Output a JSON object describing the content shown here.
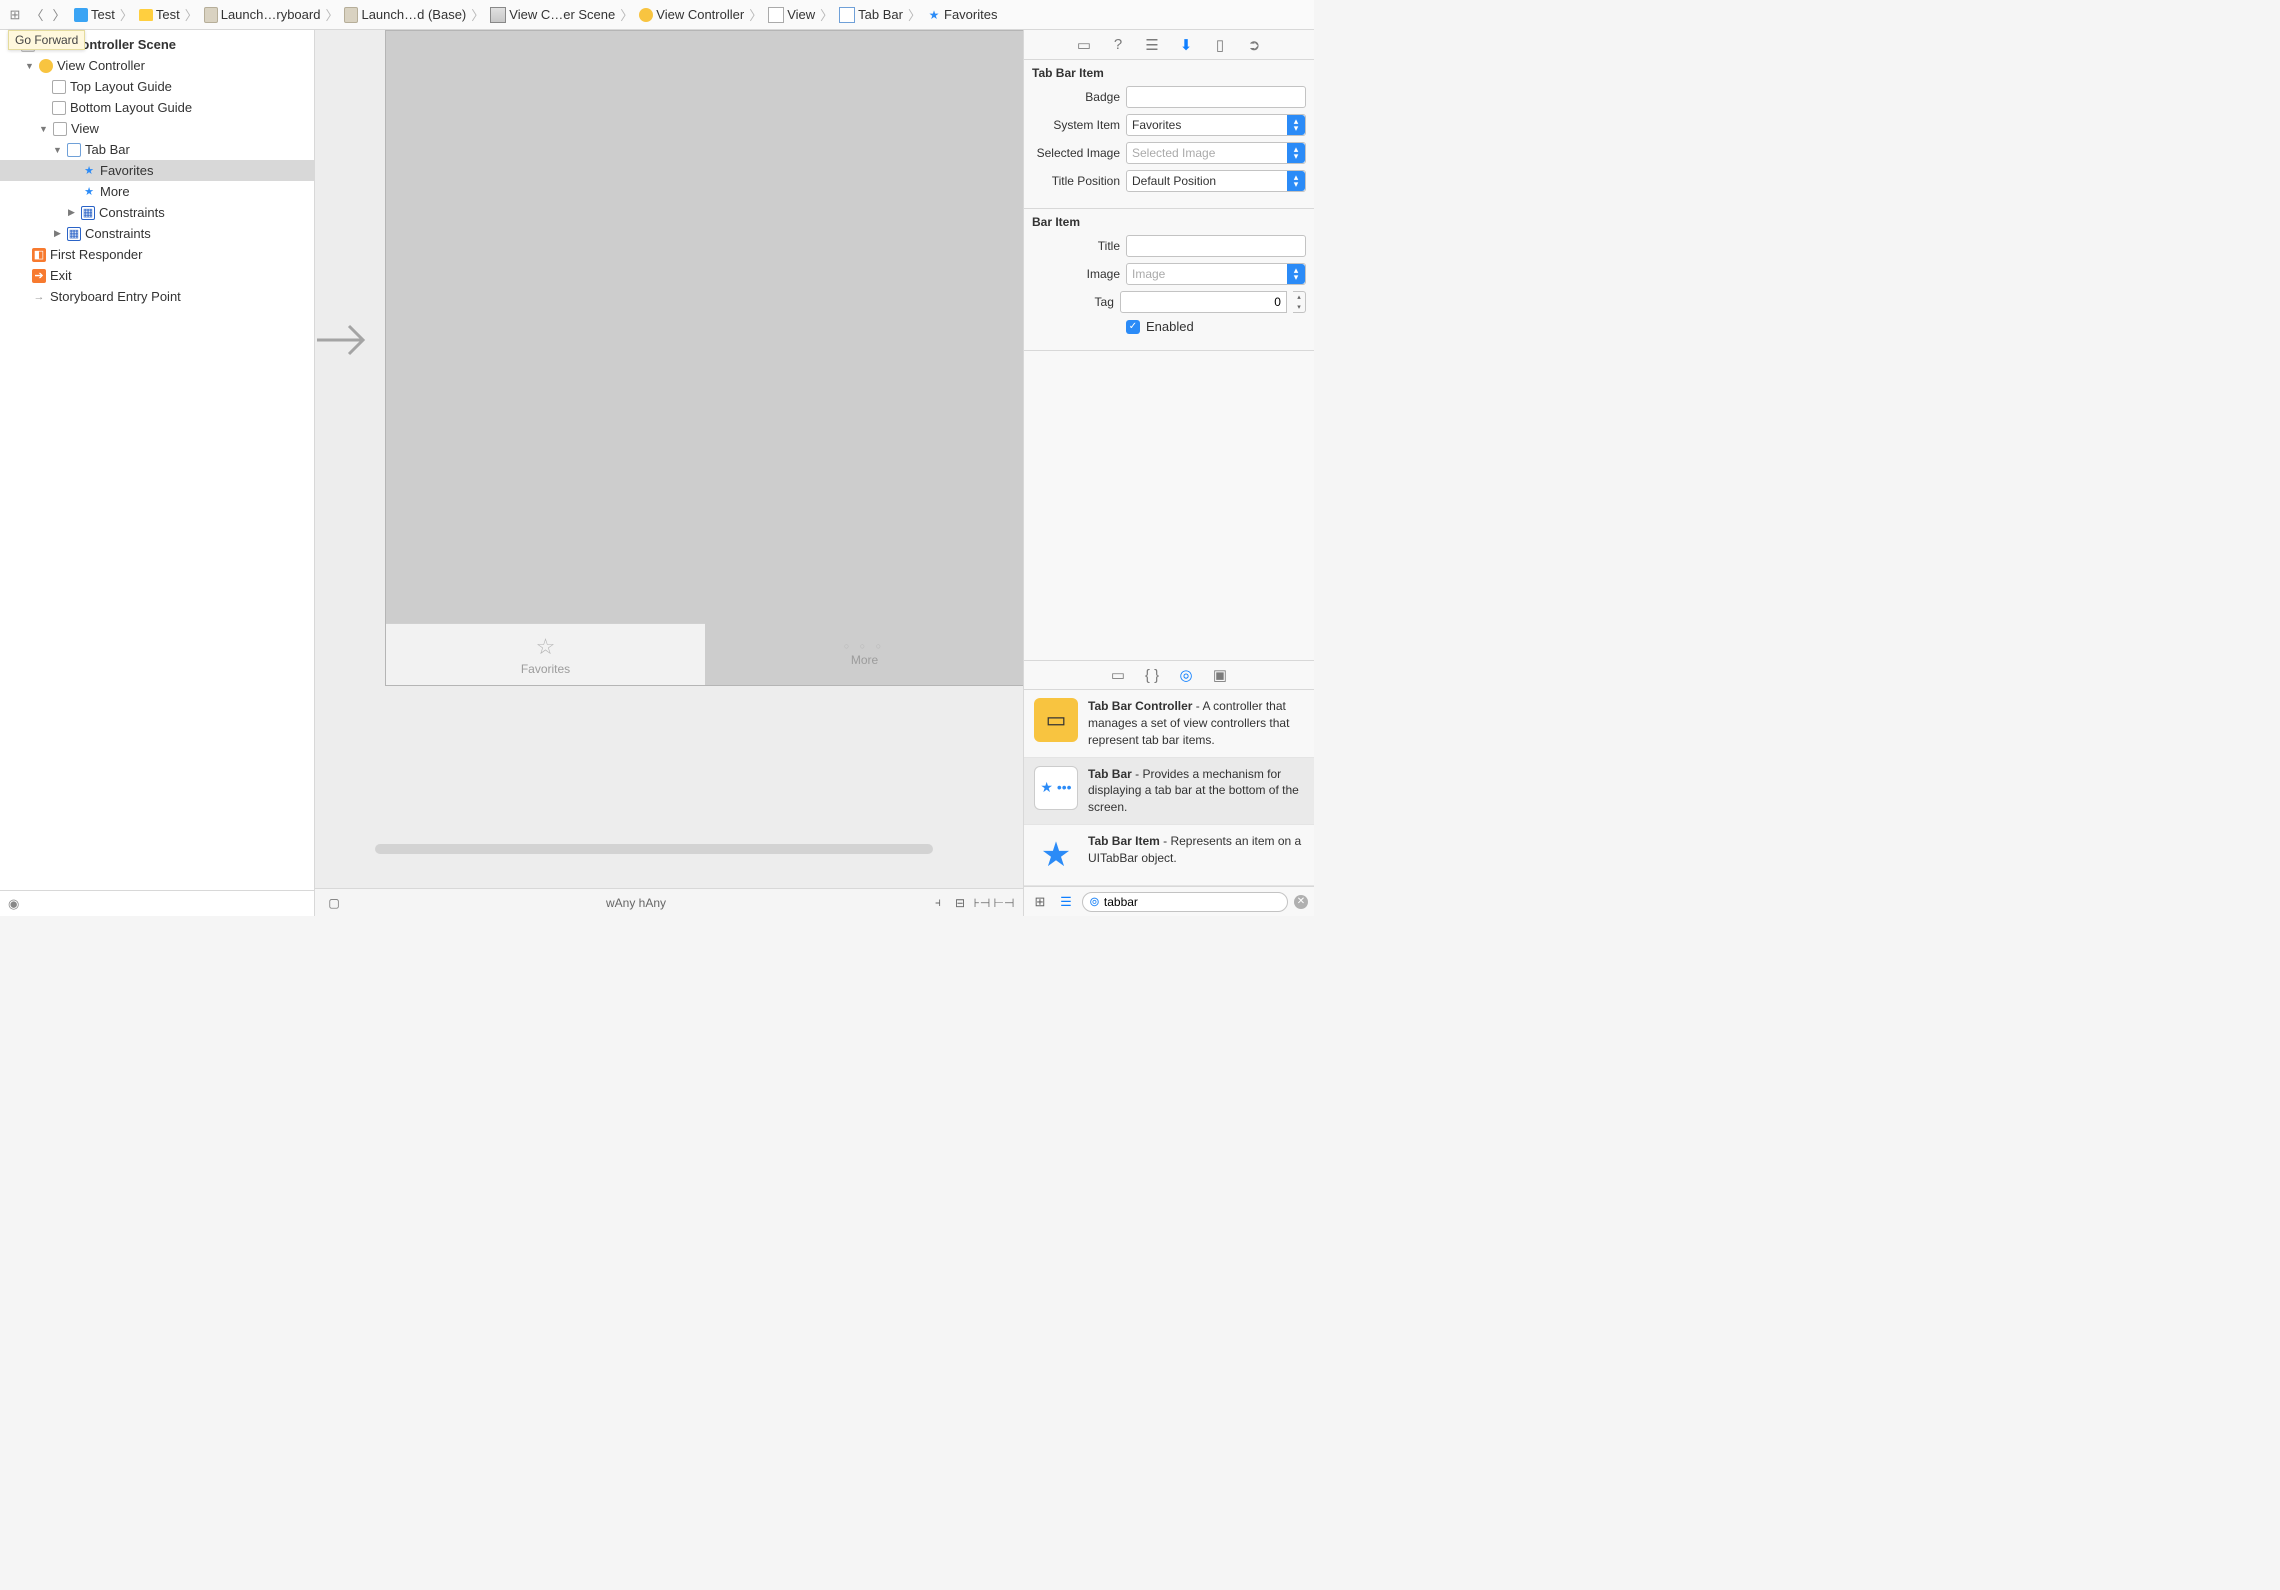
{
  "tooltip": "Go Forward",
  "breadcrumb": [
    {
      "label": "Test",
      "icon": "icon-blue"
    },
    {
      "label": "Test",
      "icon": "icon-folder"
    },
    {
      "label": "Launch…ryboard",
      "icon": "icon-file"
    },
    {
      "label": "Launch…d (Base)",
      "icon": "icon-file"
    },
    {
      "label": "View C…er Scene",
      "icon": "icon-storyboard"
    },
    {
      "label": "View Controller",
      "icon": "icon-vc"
    },
    {
      "label": "View",
      "icon": "icon-view"
    },
    {
      "label": "Tab Bar",
      "icon": "icon-tabbar"
    },
    {
      "label": "Favorites",
      "icon": "icon-star"
    }
  ],
  "outline": {
    "root": "View Controller Scene",
    "vc": "View Controller",
    "top_guide": "Top Layout Guide",
    "bottom_guide": "Bottom Layout Guide",
    "view": "View",
    "tabbar": "Tab Bar",
    "favorites": "Favorites",
    "more": "More",
    "constraints_a": "Constraints",
    "constraints_b": "Constraints",
    "first_responder": "First Responder",
    "exit": "Exit",
    "entry": "Storyboard Entry Point"
  },
  "canvas": {
    "tab_favorites": "Favorites",
    "tab_more": "More",
    "size_class_w": "wAny",
    "size_class_h": "hAny"
  },
  "inspector": {
    "section1_title": "Tab Bar Item",
    "badge_label": "Badge",
    "badge_value": "",
    "system_item_label": "System Item",
    "system_item_value": "Favorites",
    "selected_image_label": "Selected Image",
    "selected_image_placeholder": "Selected Image",
    "title_position_label": "Title Position",
    "title_position_value": "Default Position",
    "section2_title": "Bar Item",
    "title_label": "Title",
    "title_value": "",
    "image_label": "Image",
    "image_placeholder": "Image",
    "tag_label": "Tag",
    "tag_value": "0",
    "enabled_label": "Enabled"
  },
  "library": {
    "items": [
      {
        "title": "Tab Bar Controller",
        "desc": " - A controller that manages a set of view controllers that represent tab bar items."
      },
      {
        "title": "Tab Bar",
        "desc": " - Provides a mechanism for displaying a tab bar at the bottom of the screen."
      },
      {
        "title": "Tab Bar Item",
        "desc": " - Represents an item on a UITabBar object."
      }
    ],
    "search_value": "tabbar"
  }
}
